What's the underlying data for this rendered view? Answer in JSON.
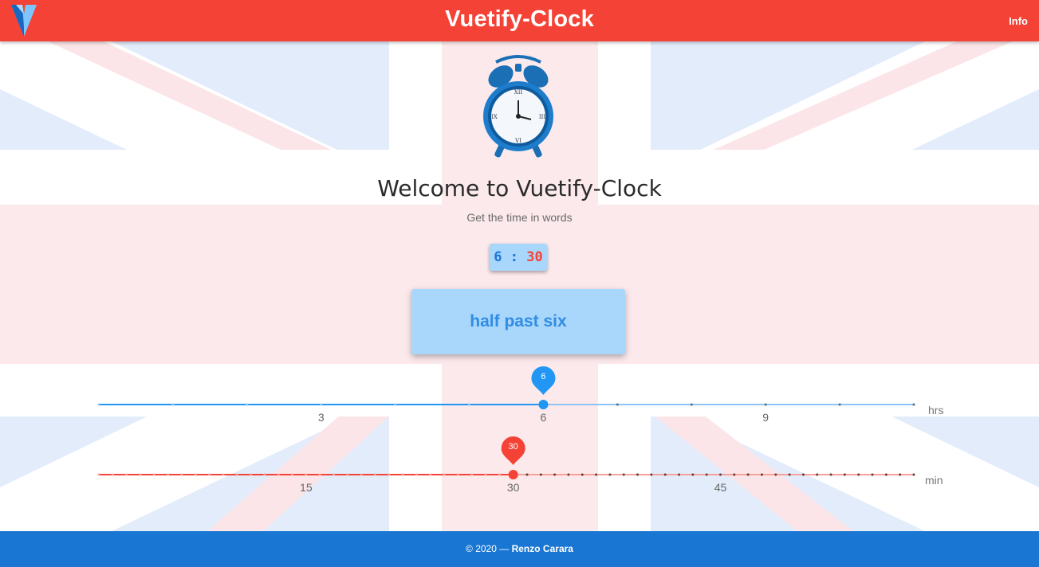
{
  "app": {
    "title": "Vuetify-Clock",
    "info_label": "Info",
    "colors": {
      "primary": "#1976d2",
      "accent": "#f44336",
      "chip_bg": "#a9d6fb"
    }
  },
  "main": {
    "welcome": "Welcome to Vuetify-Clock",
    "subtitle": "Get the time in words",
    "time": {
      "hours": "6",
      "separator": ":",
      "minutes": "30"
    },
    "time_in_words": "half past six"
  },
  "hours_slider": {
    "min": 0,
    "max": 11,
    "value": 6,
    "unit": "hrs",
    "thumb_label": "6",
    "tick_labels": [
      {
        "value": 3,
        "label": "3"
      },
      {
        "value": 6,
        "label": "6"
      },
      {
        "value": 9,
        "label": "9"
      }
    ]
  },
  "minutes_slider": {
    "min": 0,
    "max": 59,
    "value": 30,
    "unit": "min",
    "thumb_label": "30",
    "tick_labels": [
      {
        "value": 15,
        "label": "15"
      },
      {
        "value": 30,
        "label": "30"
      },
      {
        "value": 45,
        "label": "45"
      }
    ]
  },
  "footer": {
    "copyright": "© 2020 —",
    "author": "Renzo Carara"
  }
}
